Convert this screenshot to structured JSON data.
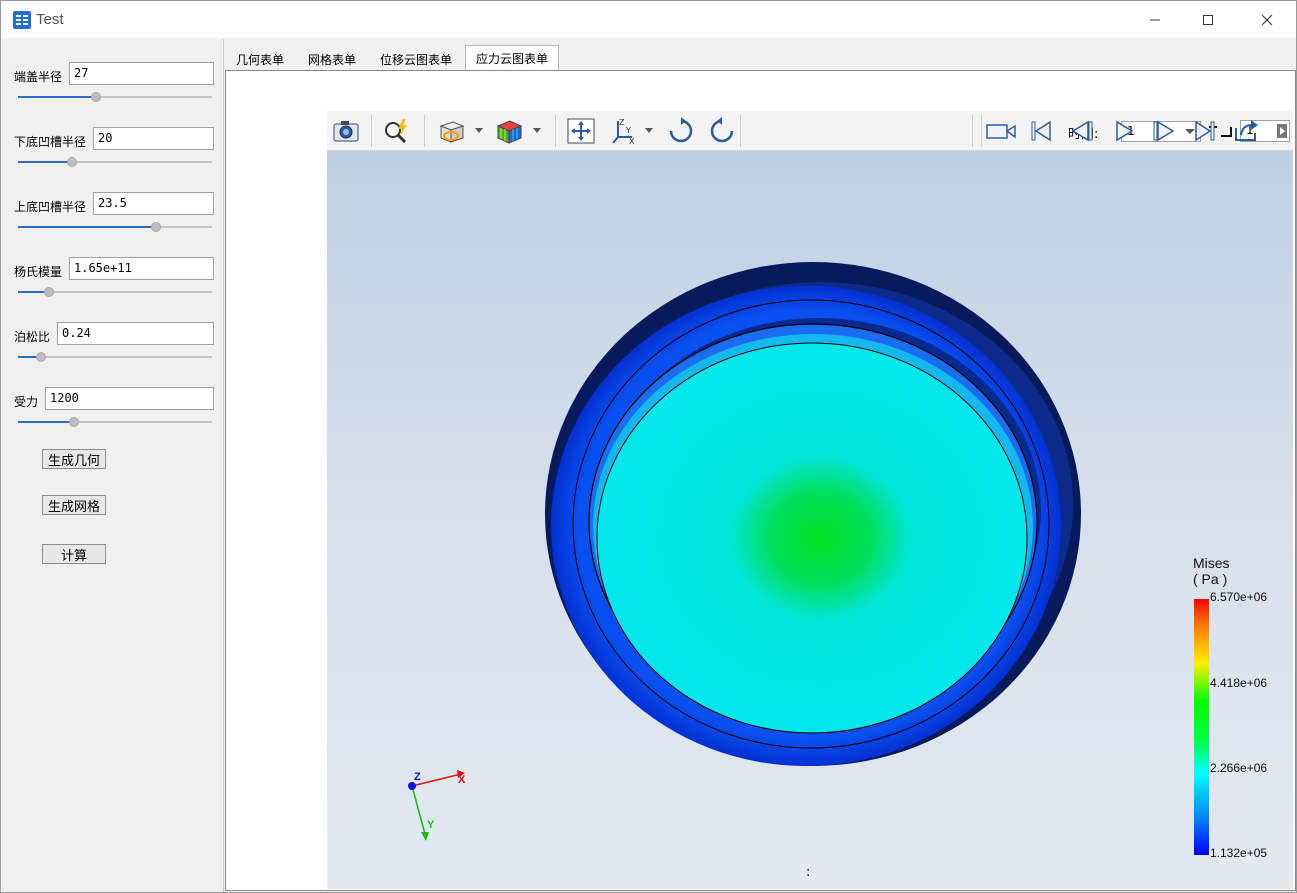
{
  "window": {
    "title": "Test"
  },
  "params": [
    {
      "label": "端盖半径",
      "value": "27",
      "level": 0.4
    },
    {
      "label": "下底凹槽半径",
      "value": "20",
      "level": 0.28
    },
    {
      "label": "上底凹槽半径",
      "value": "23.5",
      "level": 0.71
    },
    {
      "label": "杨氏模量",
      "value": "1.65e+11",
      "level": 0.16
    },
    {
      "label": "泊松比",
      "value": "0.24",
      "level": 0.12
    },
    {
      "label": "受力",
      "value": "1200",
      "level": 0.29
    }
  ],
  "buttons": {
    "generate_geometry": "生成几何",
    "generate_mesh": "生成网格",
    "compute": "计算"
  },
  "tabs": [
    {
      "label": "几何表单",
      "active": false
    },
    {
      "label": "网格表单",
      "active": false
    },
    {
      "label": "位移云图表单",
      "active": false
    },
    {
      "label": "应力云图表单",
      "active": true
    }
  ],
  "toolbar": {
    "icons": [
      "camera-icon",
      "zoom-icon",
      "display-mode-icon",
      "color-cube-icon",
      "fit-view-icon",
      "axes-icon",
      "rotate-cw-icon",
      "rotate-ccw-icon",
      "video-icon",
      "first-frame-icon",
      "prev-frame-icon",
      "play-icon",
      "next-frame-icon",
      "last-frame-icon",
      "export-icon",
      "more-icon"
    ],
    "time_label": "时间:",
    "time_value": "1",
    "step_value": "1"
  },
  "viewer": {
    "center_text": ":",
    "axes": {
      "x": "X",
      "y": "Y",
      "z": "Z"
    }
  },
  "legend": {
    "title_line1": "Mises",
    "title_line2": "( Pa )",
    "ticks": [
      "6.570e+06",
      "4.418e+06",
      "2.266e+06",
      "1.132e+05"
    ],
    "colors": {
      "max": "#ff0000",
      "mid": "#00ff00",
      "low": "#00ffff",
      "min": "#0000ff"
    }
  }
}
